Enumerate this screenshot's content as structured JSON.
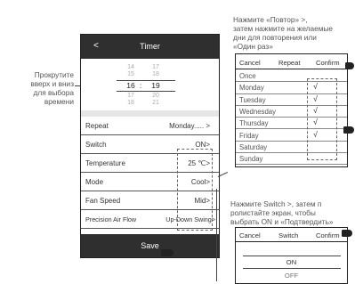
{
  "annotations": {
    "left": [
      "Прокрутите",
      "вверх и вниз",
      "для выбора",
      "времени"
    ],
    "top_right": [
      "Нажмите «Повтор» >,",
      "затем нажмите на желаемые",
      "дни для повторения или",
      "«Один раз»"
    ],
    "mid_right": [
      "Нажмите Switch >, затем п",
      "ролистайте экран, чтобы",
      "выбрать ON и «Подтвердить»"
    ]
  },
  "phone": {
    "back": "<",
    "title": "Timer",
    "picker": {
      "hours": [
        "14",
        "15",
        "16",
        "17",
        "18"
      ],
      "minutes": [
        "17",
        "18",
        "19",
        "20",
        "21"
      ],
      "colon": ":"
    },
    "rows": [
      {
        "label": "Repeat",
        "value": "Monday..... >"
      },
      {
        "label": "Switch",
        "value": "ON>"
      },
      {
        "label": "Temperature",
        "value": "25 ℃>"
      },
      {
        "label": "Mode",
        "value": "Cool>"
      },
      {
        "label": "Fan Speed",
        "value": "Mid>"
      },
      {
        "label": "Precision Air Flow",
        "value": "Up-Down Swing>"
      }
    ],
    "save": "Save"
  },
  "repeat_panel": {
    "cancel": "Cancel",
    "title": "Repeat",
    "confirm": "Confirm",
    "days": [
      {
        "name": "Once",
        "checked": false
      },
      {
        "name": "Monday",
        "checked": true
      },
      {
        "name": "Tuesday",
        "checked": true
      },
      {
        "name": "Wednesday",
        "checked": true
      },
      {
        "name": "Thursday",
        "checked": true
      },
      {
        "name": "Friday",
        "checked": true
      },
      {
        "name": "Saturday",
        "checked": false
      },
      {
        "name": "Sunday",
        "checked": false
      }
    ],
    "check_mark": "√"
  },
  "switch_panel": {
    "cancel": "Cancel",
    "title": "Switch",
    "confirm": "Confirm",
    "options": [
      "ON",
      "OFF"
    ]
  }
}
